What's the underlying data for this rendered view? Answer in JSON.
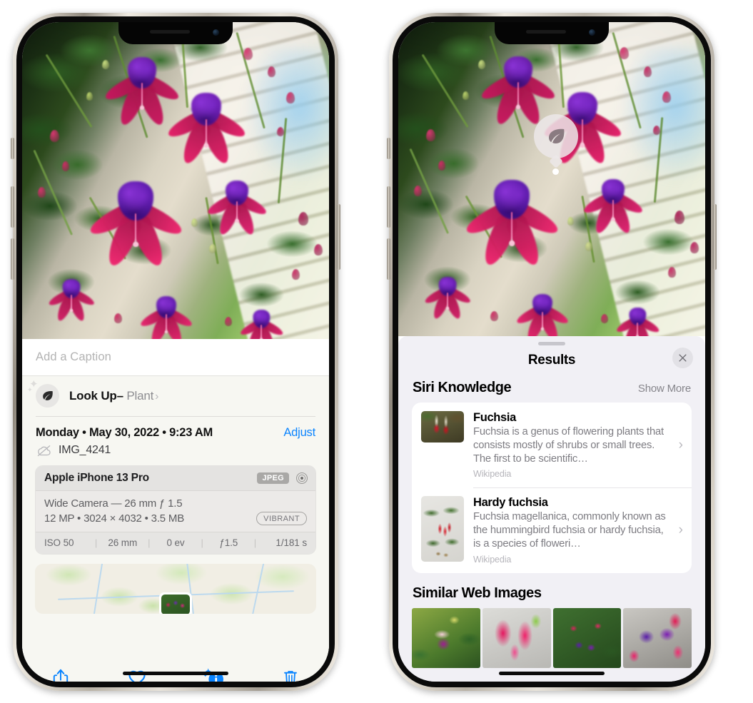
{
  "left_phone": {
    "name": "iphone-photos-detail",
    "caption_placeholder": "Add a Caption",
    "lookup": {
      "label": "Look Up",
      "dash": "–",
      "subject": "Plant",
      "chevron": "›",
      "icon": "leaf-icon"
    },
    "meta": {
      "date": "Monday • May 30, 2022 • 9:23 AM",
      "adjust": "Adjust",
      "filename": "IMG_4241",
      "cloud_icon": "cloud-slash-icon"
    },
    "camera": {
      "model": "Apple iPhone 13 Pro",
      "format_badge": "JPEG",
      "aperture_icon": "aperture-icon",
      "lens_line": "Wide Camera — 26 mm ƒ 1.5",
      "size_line": "12 MP • 3024 × 4032 • 3.5 MB",
      "style_badge": "VIBRANT",
      "exif": [
        "ISO 50",
        "26 mm",
        "0 ev",
        "ƒ1.5",
        "1/181 s"
      ],
      "exif_separator": "|"
    },
    "toolbar": [
      {
        "name": "share-button",
        "icon": "share-icon"
      },
      {
        "name": "favorite-button",
        "icon": "heart-icon"
      },
      {
        "name": "visual-lookup-info-button",
        "icon": "info-sparkle-icon"
      },
      {
        "name": "delete-button",
        "icon": "trash-icon"
      }
    ],
    "map": {
      "name": "location-map-thumbnail",
      "pin": "photo-pin"
    }
  },
  "right_phone": {
    "name": "iphone-visual-lookup-results",
    "badge": {
      "name": "visual-lookup-leaf-badge",
      "icon": "leaf-icon"
    },
    "sheet": {
      "title": "Results",
      "close_icon": "close-icon",
      "sections": [
        {
          "title": "Siri Knowledge",
          "action": "Show More",
          "items": [
            {
              "title": "Fuchsia",
              "description": "Fuchsia is a genus of flowering plants that consists mostly of shrubs or small trees. The first to be scientific…",
              "source": "Wikipedia",
              "thumb": "fuchsia-red-flowers-thumbnail",
              "chevron": "›"
            },
            {
              "title": "Hardy fuchsia",
              "description": "Fuchsia magellanica, commonly known as the hummingbird fuchsia or hardy fuchsia, is a species of floweri…",
              "source": "Wikipedia",
              "thumb": "hardy-fuchsia-specimen-thumbnail",
              "chevron": "›"
            }
          ]
        },
        {
          "title": "Similar Web Images",
          "images": [
            {
              "name": "similar-web-image-1"
            },
            {
              "name": "similar-web-image-2"
            },
            {
              "name": "similar-web-image-3"
            },
            {
              "name": "similar-web-image-4"
            }
          ]
        }
      ]
    }
  },
  "colors": {
    "accent_blue": "#0a84ff",
    "sheet_bg": "#f1f0f5",
    "info_bg": "#f7f7f2",
    "card_bg": "#ffffff",
    "secondary_text": "#8d8d91"
  }
}
